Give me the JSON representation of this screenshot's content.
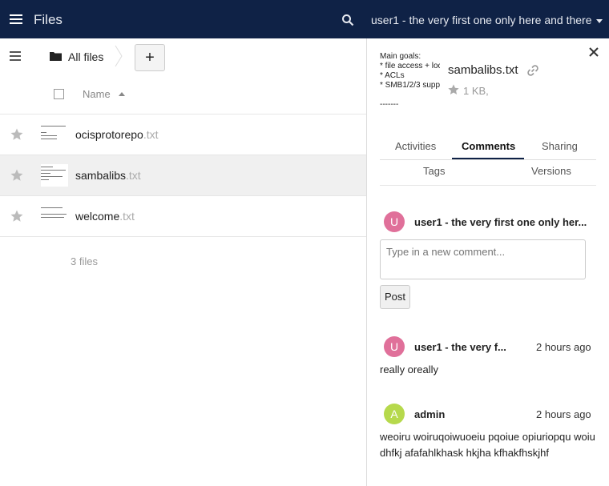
{
  "header": {
    "app_title": "Files",
    "user_label": "user1 - the very first one only here and there",
    "colors": {
      "background": "#0f2246"
    }
  },
  "controls": {
    "breadcrumb_label": "All files",
    "add_label": "+"
  },
  "list": {
    "column_name": "Name",
    "files": [
      {
        "name": "ocisprotorepo",
        "ext": ".txt",
        "preview_lines": [
          "an repository co",
          "",
          "|--- buf.lock",
          "|--- buf.yaml"
        ]
      },
      {
        "name": "sambalibs",
        "ext": ".txt",
        "preview_lines": [
          "Main goals:",
          "* file access + loc",
          "* ACLs",
          "* SMB1/2/3 supp",
          "-------"
        ]
      },
      {
        "name": "welcome",
        "ext": ".txt",
        "preview_lines": [
          "Welcome to your",
          "",
          "This is just an exa",
          "The packaged an"
        ]
      }
    ],
    "file_count": "3 files"
  },
  "sidebar": {
    "preview_lines": [
      "Main goals:",
      "* file access + loc",
      "* ACLs",
      "* SMB1/2/3 supp",
      "",
      "-------"
    ],
    "filename": "sambalibs.txt",
    "size": "1 KB,",
    "tabs_row1": [
      "Activities",
      "Comments",
      "Sharing"
    ],
    "active_tab": "Comments",
    "tabs_row2": [
      "Tags",
      "Versions"
    ],
    "composer": {
      "avatar_letter": "U",
      "author": "user1 - the very first one only her...",
      "placeholder": "Type in a new comment...",
      "post_label": "Post"
    },
    "comments": [
      {
        "avatar_letter": "U",
        "avatar_color": "#e0709a",
        "author": "user1 - the very f...",
        "time": "2 hours ago",
        "text": "really oreally"
      },
      {
        "avatar_letter": "A",
        "avatar_color": "#b6d94c",
        "author": "admin",
        "time": "2 hours ago",
        "text": "weoiru woiruqoiwuoeiu pqoiue opiuriopqu woiu dhfkj afafahlkhask hkjha kfhakfhskjhf"
      }
    ]
  }
}
